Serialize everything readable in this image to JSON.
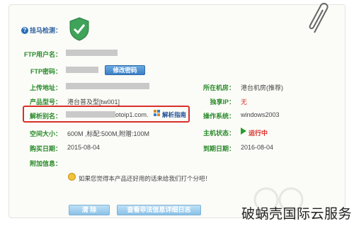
{
  "header": {
    "label": "挂马检测："
  },
  "fields": {
    "ftp_user_label": "FTP用户名：",
    "ftp_pass_label": "FTP密码：",
    "edit_password_button": "修改密码",
    "upload_addr_label": "上传地址：",
    "product_model_label": "产品型号：",
    "product_model_value": "港台普及型[tw001]",
    "domain_label": "解析别名：",
    "domain_value_suffix": "otoip1.com.",
    "guide_link": "解析指南",
    "space_label": "空间大小：",
    "space_value": "600M ,标配:500M,附赠:100M",
    "purchase_date_label": "购买日期：",
    "purchase_date_value": "2015-08-04",
    "attach_info_label": "附加信息：",
    "room_label": "所在机房：",
    "room_value": "港台机房(推荐)",
    "exclusive_ip_label": "独享IP：",
    "exclusive_ip_value": "无",
    "os_label": "操作系统：",
    "os_value": "windows2003",
    "host_status_label": "主机状态：",
    "host_status_value": "运行中",
    "expire_date_label": "到期日期：",
    "expire_date_value": "2016-08-04"
  },
  "feedback_text": "如果您觉得本产品还好用的话来给我们打个分吧！",
  "buttons": {
    "clear": "清 除",
    "view_log": "查看非法信息详细日志"
  },
  "watermark": "破蜗壳国际云服务",
  "colors": {
    "label_green": "#2a8a2a",
    "highlight_red": "#d9302a",
    "button_blue": "#3b7fc7"
  }
}
